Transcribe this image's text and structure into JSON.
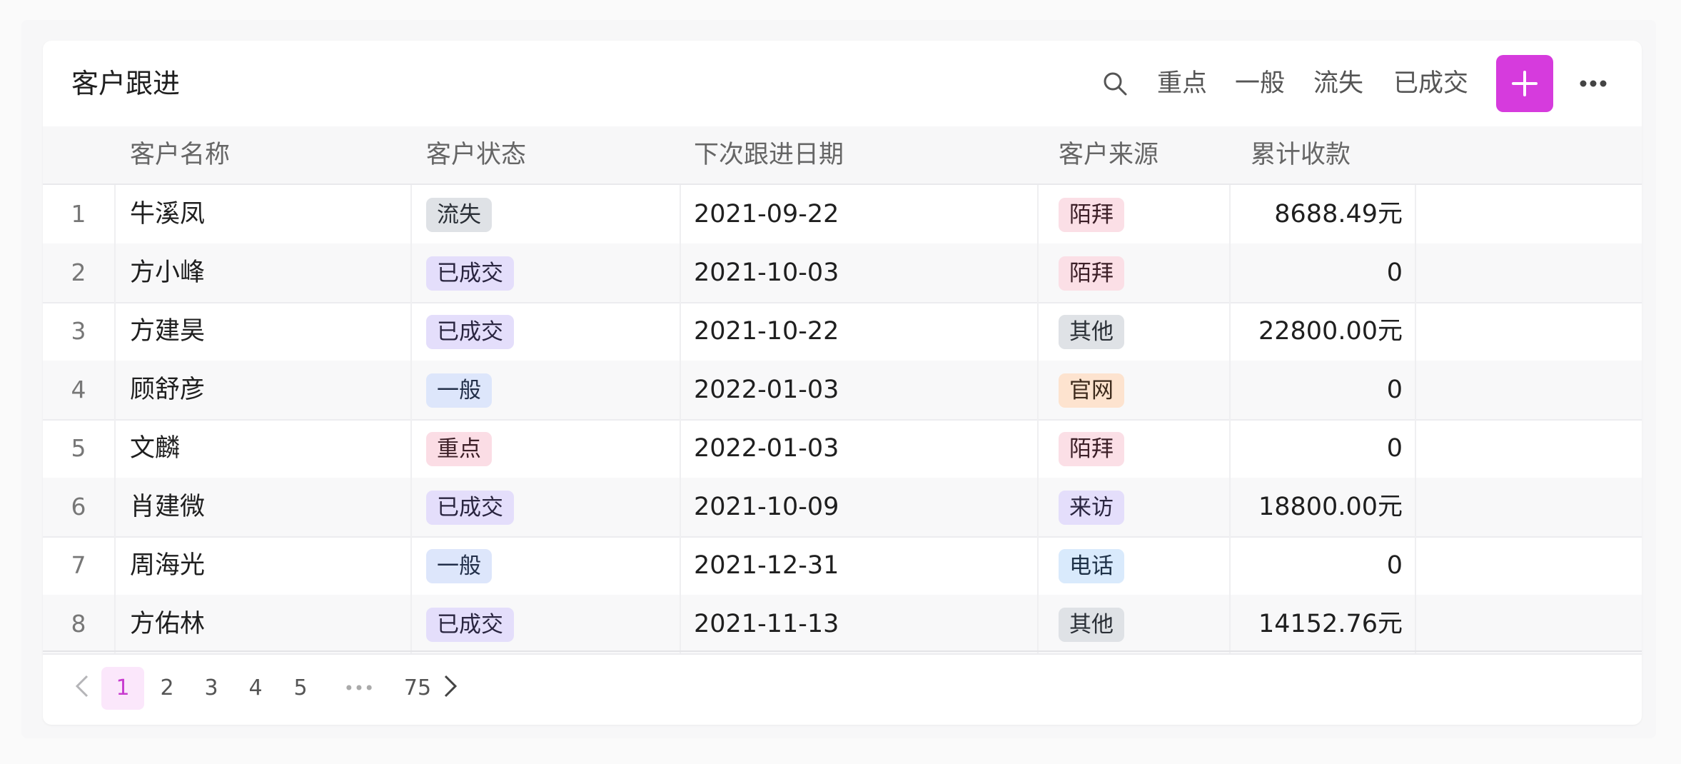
{
  "header": {
    "title": "客户跟进",
    "filters": [
      "重点",
      "一般",
      "流失",
      "已成交"
    ],
    "add_label": "+",
    "search_icon": "search-icon",
    "more_icon": "more-horizontal-icon",
    "add_color": "#d63bdd"
  },
  "table": {
    "columns": [
      "客户名称",
      "客户状态",
      "下次跟进日期",
      "客户来源",
      "累计收款"
    ],
    "rows": [
      {
        "index": "1",
        "name": "牛溪凤",
        "status": "流失",
        "date": "2021-09-22",
        "source": "陌拜",
        "amount": "8688.49元"
      },
      {
        "index": "2",
        "name": "方小峰",
        "status": "已成交",
        "date": "2021-10-03",
        "source": "陌拜",
        "amount": "0"
      },
      {
        "index": "3",
        "name": "方建昊",
        "status": "已成交",
        "date": "2021-10-22",
        "source": "其他",
        "amount": "22800.00元"
      },
      {
        "index": "4",
        "name": "顾舒彦",
        "status": "一般",
        "date": "2022-01-03",
        "source": "官网",
        "amount": "0"
      },
      {
        "index": "5",
        "name": "文麟",
        "status": "重点",
        "date": "2022-01-03",
        "source": "陌拜",
        "amount": "0"
      },
      {
        "index": "6",
        "name": "肖建微",
        "status": "已成交",
        "date": "2021-10-09",
        "source": "来访",
        "amount": "18800.00元"
      },
      {
        "index": "7",
        "name": "周海光",
        "status": "一般",
        "date": "2021-12-31",
        "source": "电话",
        "amount": "0"
      },
      {
        "index": "8",
        "name": "方佑林",
        "status": "已成交",
        "date": "2021-11-13",
        "source": "其他",
        "amount": "14152.76元"
      }
    ],
    "tag_colors": {
      "流失": {
        "bg": "#dfe2e6",
        "fg": "#2a2f36"
      },
      "已成交": {
        "bg": "#e4defb",
        "fg": "#2a2540"
      },
      "一般": {
        "bg": "#dde6fb",
        "fg": "#23304a"
      },
      "重点": {
        "bg": "#fbdde5",
        "fg": "#3d2028"
      },
      "陌拜": {
        "bg": "#fbdfe6",
        "fg": "#3d2028"
      },
      "其他": {
        "bg": "#dfe2e6",
        "fg": "#2a2f36"
      },
      "官网": {
        "bg": "#fde3cf",
        "fg": "#3d2a1c"
      },
      "来访": {
        "bg": "#e4defb",
        "fg": "#2a2540"
      },
      "电话": {
        "bg": "#d9eafc",
        "fg": "#1f3248"
      }
    }
  },
  "pagination": {
    "prev_icon": "chevron-left-icon",
    "next_icon": "chevron-right-icon",
    "pages": [
      "1",
      "2",
      "3",
      "4",
      "5"
    ],
    "ellipsis": "•••",
    "last_page": "75",
    "current": "1",
    "active_bg": "#fbe7fb",
    "active_color": "#c83bcf"
  }
}
